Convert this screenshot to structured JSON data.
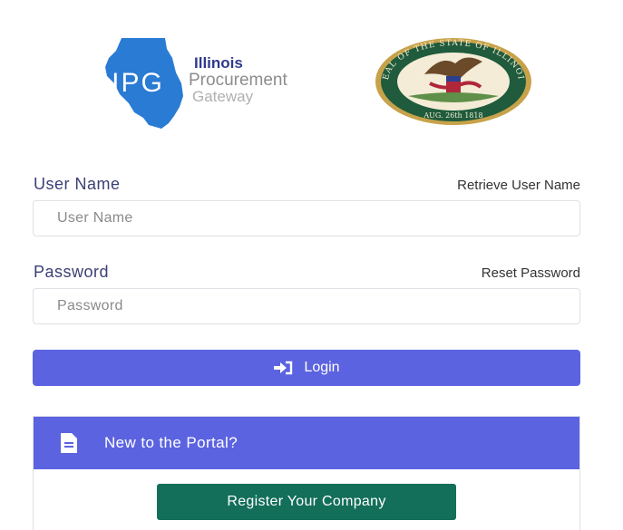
{
  "logo": {
    "initials": "IPG",
    "line1": "Illinois",
    "line2": "Procurement",
    "line3": "Gateway",
    "colors": {
      "blue": "#2a7bd4",
      "gray": "#9a9a9a",
      "navy": "#2f3a8f"
    }
  },
  "seal": {
    "ring_text": "SEAL OF THE STATE OF ILLINOIS",
    "date_text": "AUG. 26th 1818",
    "colors": {
      "green": "#1f5b3c",
      "gold": "#c7a24a"
    }
  },
  "username": {
    "label": "User Name",
    "link": "Retrieve User Name",
    "placeholder": "User Name",
    "value": ""
  },
  "password": {
    "label": "Password",
    "link": "Reset Password",
    "placeholder": "Password",
    "value": ""
  },
  "login": {
    "label": "Login",
    "icon": "sign-in-icon",
    "color": "#5b63e0"
  },
  "portal": {
    "title": "New to the Portal?",
    "icon": "document-icon",
    "register_label": "Register Your Company",
    "register_color": "#136e5a"
  }
}
